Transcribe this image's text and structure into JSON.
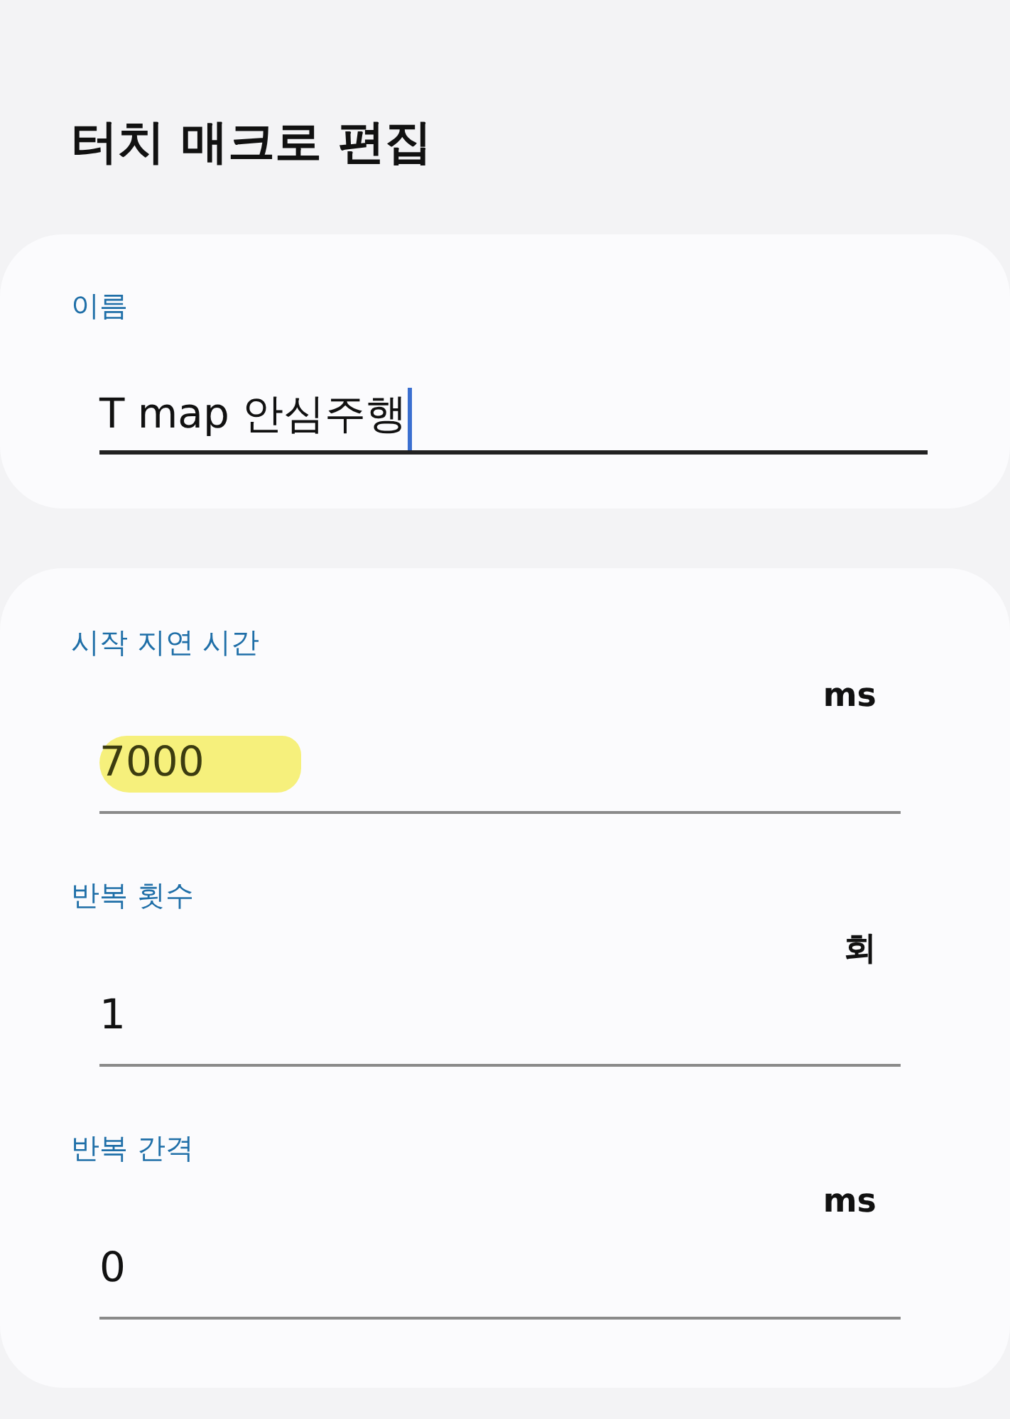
{
  "screen": {
    "title": "터치 매크로 편집"
  },
  "name_card": {
    "label": "이름",
    "value": "T map 안심주행",
    "focused": true
  },
  "settings": [
    {
      "label": "시작 지연 시간",
      "unit": "ms",
      "value": "7000",
      "highlighted": true
    },
    {
      "label": "반복 횟수",
      "unit": "회",
      "value": "1",
      "highlighted": false
    },
    {
      "label": "반복 간격",
      "unit": "ms",
      "value": "0",
      "highlighted": false
    }
  ]
}
